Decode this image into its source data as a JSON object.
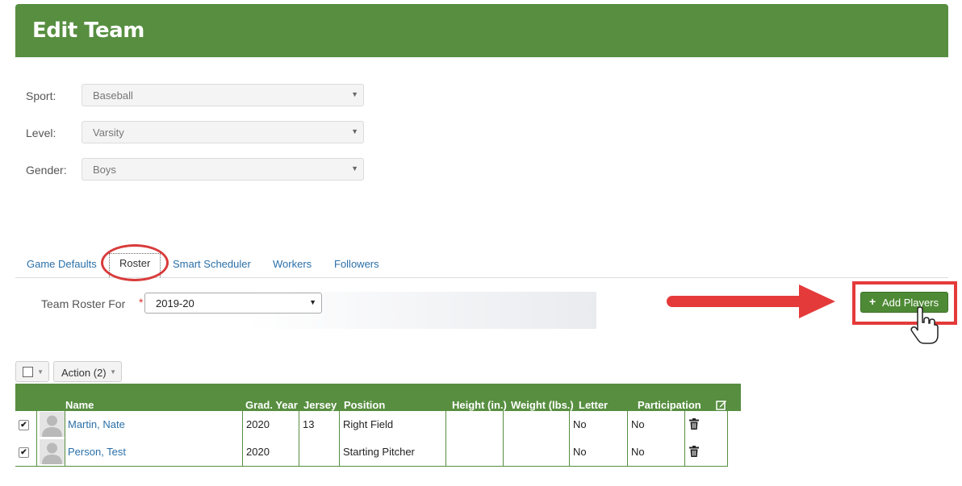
{
  "page": {
    "title": "Edit Team"
  },
  "form": {
    "sport": {
      "label": "Sport:",
      "value": "Baseball"
    },
    "level": {
      "label": "Level:",
      "value": "Varsity"
    },
    "gender": {
      "label": "Gender:",
      "value": "Boys"
    }
  },
  "tabs": [
    {
      "label": "Game Defaults"
    },
    {
      "label": "Roster",
      "active": true
    },
    {
      "label": "Smart Scheduler"
    },
    {
      "label": "Workers"
    },
    {
      "label": "Followers"
    }
  ],
  "roster": {
    "label": "Team Roster For",
    "required_mark": "*",
    "season": "2019-20",
    "add_players_label": "Add Players"
  },
  "controls": {
    "action_label": "Action (2)"
  },
  "table": {
    "columns": [
      "Name",
      "Grad. Year",
      "Jersey",
      "Position",
      "Height (in.)",
      "Weight (lbs.)",
      "Letter",
      "Participation"
    ],
    "rows": [
      {
        "checked": "✔",
        "name": "Martin, Nate",
        "grad_year": "2020",
        "jersey": "13",
        "position": "Right Field",
        "height": "",
        "weight": "",
        "letter": "No",
        "participation": "No"
      },
      {
        "checked": "✔",
        "name": "Person, Test",
        "grad_year": "2020",
        "jersey": "",
        "position": "Starting Pitcher",
        "height": "",
        "weight": "",
        "letter": "No",
        "participation": "No"
      }
    ]
  },
  "icons": {
    "edit": "edit-icon",
    "trash": "trash-icon",
    "avatar": "user-avatar-icon",
    "caret": "chevron-down-icon",
    "plus": "plus-icon"
  },
  "colors": {
    "brand_green": "#578e40",
    "button_green": "#4e8a35",
    "annotation_red": "#e53a3a",
    "link_blue": "#2a6fa8"
  }
}
